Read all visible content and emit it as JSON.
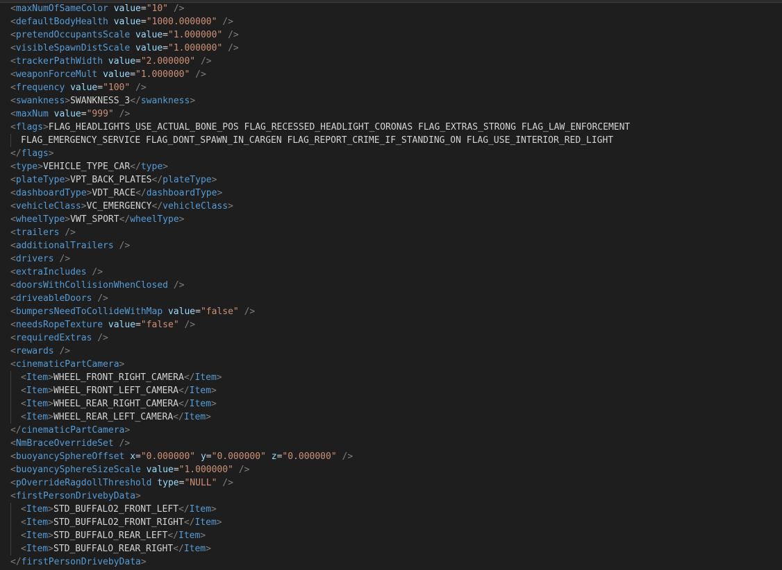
{
  "colors": {
    "background": "#1e1e1e",
    "punctuation": "#808080",
    "tag": "#569cd6",
    "attribute": "#9cdcfe",
    "string": "#ce9178",
    "text": "#d4d4d4"
  },
  "lines": [
    {
      "indent": 0,
      "tokens": [
        [
          "p",
          "<"
        ],
        [
          "t",
          "maxNumOfSameColor"
        ],
        [
          "x",
          " "
        ],
        [
          "a",
          "value"
        ],
        [
          "x",
          "="
        ],
        [
          "s",
          "\"10\""
        ],
        [
          "x",
          " "
        ],
        [
          "p",
          "/>"
        ]
      ]
    },
    {
      "indent": 0,
      "tokens": [
        [
          "p",
          "<"
        ],
        [
          "t",
          "defaultBodyHealth"
        ],
        [
          "x",
          " "
        ],
        [
          "a",
          "value"
        ],
        [
          "x",
          "="
        ],
        [
          "s",
          "\"1000.000000\""
        ],
        [
          "x",
          " "
        ],
        [
          "p",
          "/>"
        ]
      ]
    },
    {
      "indent": 0,
      "tokens": [
        [
          "p",
          "<"
        ],
        [
          "t",
          "pretendOccupantsScale"
        ],
        [
          "x",
          " "
        ],
        [
          "a",
          "value"
        ],
        [
          "x",
          "="
        ],
        [
          "s",
          "\"1.000000\""
        ],
        [
          "x",
          " "
        ],
        [
          "p",
          "/>"
        ]
      ]
    },
    {
      "indent": 0,
      "tokens": [
        [
          "p",
          "<"
        ],
        [
          "t",
          "visibleSpawnDistScale"
        ],
        [
          "x",
          " "
        ],
        [
          "a",
          "value"
        ],
        [
          "x",
          "="
        ],
        [
          "s",
          "\"1.000000\""
        ],
        [
          "x",
          " "
        ],
        [
          "p",
          "/>"
        ]
      ]
    },
    {
      "indent": 0,
      "tokens": [
        [
          "p",
          "<"
        ],
        [
          "t",
          "trackerPathWidth"
        ],
        [
          "x",
          " "
        ],
        [
          "a",
          "value"
        ],
        [
          "x",
          "="
        ],
        [
          "s",
          "\"2.000000\""
        ],
        [
          "x",
          " "
        ],
        [
          "p",
          "/>"
        ]
      ]
    },
    {
      "indent": 0,
      "tokens": [
        [
          "p",
          "<"
        ],
        [
          "t",
          "weaponForceMult"
        ],
        [
          "x",
          " "
        ],
        [
          "a",
          "value"
        ],
        [
          "x",
          "="
        ],
        [
          "s",
          "\"1.000000\""
        ],
        [
          "x",
          " "
        ],
        [
          "p",
          "/>"
        ]
      ]
    },
    {
      "indent": 0,
      "tokens": [
        [
          "p",
          "<"
        ],
        [
          "t",
          "frequency"
        ],
        [
          "x",
          " "
        ],
        [
          "a",
          "value"
        ],
        [
          "x",
          "="
        ],
        [
          "s",
          "\"100\""
        ],
        [
          "x",
          " "
        ],
        [
          "p",
          "/>"
        ]
      ]
    },
    {
      "indent": 0,
      "tokens": [
        [
          "p",
          "<"
        ],
        [
          "t",
          "swankness"
        ],
        [
          "p",
          ">"
        ],
        [
          "x",
          "SWANKNESS_3"
        ],
        [
          "p",
          "</"
        ],
        [
          "t",
          "swankness"
        ],
        [
          "p",
          ">"
        ]
      ]
    },
    {
      "indent": 0,
      "tokens": [
        [
          "p",
          "<"
        ],
        [
          "t",
          "maxNum"
        ],
        [
          "x",
          " "
        ],
        [
          "a",
          "value"
        ],
        [
          "x",
          "="
        ],
        [
          "s",
          "\"999\""
        ],
        [
          "x",
          " "
        ],
        [
          "p",
          "/>"
        ]
      ]
    },
    {
      "indent": 0,
      "tokens": [
        [
          "p",
          "<"
        ],
        [
          "t",
          "flags"
        ],
        [
          "p",
          ">"
        ],
        [
          "x",
          "FLAG_HEADLIGHTS_USE_ACTUAL_BONE_POS FLAG_RECESSED_HEADLIGHT_CORONAS FLAG_EXTRAS_STRONG FLAG_LAW_ENFORCEMENT"
        ]
      ]
    },
    {
      "indent": 1,
      "tokens": [
        [
          "x",
          "FLAG_EMERGENCY_SERVICE FLAG_DONT_SPAWN_IN_CARGEN FLAG_REPORT_CRIME_IF_STANDING_ON FLAG_USE_INTERIOR_RED_LIGHT"
        ]
      ]
    },
    {
      "indent": 0,
      "tokens": [
        [
          "p",
          "</"
        ],
        [
          "t",
          "flags"
        ],
        [
          "p",
          ">"
        ]
      ]
    },
    {
      "indent": 0,
      "tokens": [
        [
          "p",
          "<"
        ],
        [
          "t",
          "type"
        ],
        [
          "p",
          ">"
        ],
        [
          "x",
          "VEHICLE_TYPE_CAR"
        ],
        [
          "p",
          "</"
        ],
        [
          "t",
          "type"
        ],
        [
          "p",
          ">"
        ]
      ]
    },
    {
      "indent": 0,
      "tokens": [
        [
          "p",
          "<"
        ],
        [
          "t",
          "plateType"
        ],
        [
          "p",
          ">"
        ],
        [
          "x",
          "VPT_BACK_PLATES"
        ],
        [
          "p",
          "</"
        ],
        [
          "t",
          "plateType"
        ],
        [
          "p",
          ">"
        ]
      ]
    },
    {
      "indent": 0,
      "tokens": [
        [
          "p",
          "<"
        ],
        [
          "t",
          "dashboardType"
        ],
        [
          "p",
          ">"
        ],
        [
          "x",
          "VDT_RACE"
        ],
        [
          "p",
          "</"
        ],
        [
          "t",
          "dashboardType"
        ],
        [
          "p",
          ">"
        ]
      ]
    },
    {
      "indent": 0,
      "tokens": [
        [
          "p",
          "<"
        ],
        [
          "t",
          "vehicleClass"
        ],
        [
          "p",
          ">"
        ],
        [
          "x",
          "VC_EMERGENCY"
        ],
        [
          "p",
          "</"
        ],
        [
          "t",
          "vehicleClass"
        ],
        [
          "p",
          ">"
        ]
      ]
    },
    {
      "indent": 0,
      "tokens": [
        [
          "p",
          "<"
        ],
        [
          "t",
          "wheelType"
        ],
        [
          "p",
          ">"
        ],
        [
          "x",
          "VWT_SPORT"
        ],
        [
          "p",
          "</"
        ],
        [
          "t",
          "wheelType"
        ],
        [
          "p",
          ">"
        ]
      ]
    },
    {
      "indent": 0,
      "tokens": [
        [
          "p",
          "<"
        ],
        [
          "t",
          "trailers"
        ],
        [
          "x",
          " "
        ],
        [
          "p",
          "/>"
        ]
      ]
    },
    {
      "indent": 0,
      "tokens": [
        [
          "p",
          "<"
        ],
        [
          "t",
          "additionalTrailers"
        ],
        [
          "x",
          " "
        ],
        [
          "p",
          "/>"
        ]
      ]
    },
    {
      "indent": 0,
      "tokens": [
        [
          "p",
          "<"
        ],
        [
          "t",
          "drivers"
        ],
        [
          "x",
          " "
        ],
        [
          "p",
          "/>"
        ]
      ]
    },
    {
      "indent": 0,
      "tokens": [
        [
          "p",
          "<"
        ],
        [
          "t",
          "extraIncludes"
        ],
        [
          "x",
          " "
        ],
        [
          "p",
          "/>"
        ]
      ]
    },
    {
      "indent": 0,
      "tokens": [
        [
          "p",
          "<"
        ],
        [
          "t",
          "doorsWithCollisionWhenClosed"
        ],
        [
          "x",
          " "
        ],
        [
          "p",
          "/>"
        ]
      ]
    },
    {
      "indent": 0,
      "tokens": [
        [
          "p",
          "<"
        ],
        [
          "t",
          "driveableDoors"
        ],
        [
          "x",
          " "
        ],
        [
          "p",
          "/>"
        ]
      ]
    },
    {
      "indent": 0,
      "tokens": [
        [
          "p",
          "<"
        ],
        [
          "t",
          "bumpersNeedToCollideWithMap"
        ],
        [
          "x",
          " "
        ],
        [
          "a",
          "value"
        ],
        [
          "x",
          "="
        ],
        [
          "s",
          "\"false\""
        ],
        [
          "x",
          " "
        ],
        [
          "p",
          "/>"
        ]
      ]
    },
    {
      "indent": 0,
      "tokens": [
        [
          "p",
          "<"
        ],
        [
          "t",
          "needsRopeTexture"
        ],
        [
          "x",
          " "
        ],
        [
          "a",
          "value"
        ],
        [
          "x",
          "="
        ],
        [
          "s",
          "\"false\""
        ],
        [
          "x",
          " "
        ],
        [
          "p",
          "/>"
        ]
      ]
    },
    {
      "indent": 0,
      "tokens": [
        [
          "p",
          "<"
        ],
        [
          "t",
          "requiredExtras"
        ],
        [
          "x",
          " "
        ],
        [
          "p",
          "/>"
        ]
      ]
    },
    {
      "indent": 0,
      "tokens": [
        [
          "p",
          "<"
        ],
        [
          "t",
          "rewards"
        ],
        [
          "x",
          " "
        ],
        [
          "p",
          "/>"
        ]
      ]
    },
    {
      "indent": 0,
      "tokens": [
        [
          "p",
          "<"
        ],
        [
          "t",
          "cinematicPartCamera"
        ],
        [
          "p",
          ">"
        ]
      ]
    },
    {
      "indent": 1,
      "tokens": [
        [
          "p",
          "<"
        ],
        [
          "t",
          "Item"
        ],
        [
          "p",
          ">"
        ],
        [
          "x",
          "WHEEL_FRONT_RIGHT_CAMERA"
        ],
        [
          "p",
          "</"
        ],
        [
          "t",
          "Item"
        ],
        [
          "p",
          ">"
        ]
      ]
    },
    {
      "indent": 1,
      "tokens": [
        [
          "p",
          "<"
        ],
        [
          "t",
          "Item"
        ],
        [
          "p",
          ">"
        ],
        [
          "x",
          "WHEEL_FRONT_LEFT_CAMERA"
        ],
        [
          "p",
          "</"
        ],
        [
          "t",
          "Item"
        ],
        [
          "p",
          ">"
        ]
      ]
    },
    {
      "indent": 1,
      "tokens": [
        [
          "p",
          "<"
        ],
        [
          "t",
          "Item"
        ],
        [
          "p",
          ">"
        ],
        [
          "x",
          "WHEEL_REAR_RIGHT_CAMERA"
        ],
        [
          "p",
          "</"
        ],
        [
          "t",
          "Item"
        ],
        [
          "p",
          ">"
        ]
      ]
    },
    {
      "indent": 1,
      "tokens": [
        [
          "p",
          "<"
        ],
        [
          "t",
          "Item"
        ],
        [
          "p",
          ">"
        ],
        [
          "x",
          "WHEEL_REAR_LEFT_CAMERA"
        ],
        [
          "p",
          "</"
        ],
        [
          "t",
          "Item"
        ],
        [
          "p",
          ">"
        ]
      ]
    },
    {
      "indent": 0,
      "tokens": [
        [
          "p",
          "</"
        ],
        [
          "t",
          "cinematicPartCamera"
        ],
        [
          "p",
          ">"
        ]
      ]
    },
    {
      "indent": 0,
      "tokens": [
        [
          "p",
          "<"
        ],
        [
          "t",
          "NmBraceOverrideSet"
        ],
        [
          "x",
          " "
        ],
        [
          "p",
          "/>"
        ]
      ]
    },
    {
      "indent": 0,
      "tokens": [
        [
          "p",
          "<"
        ],
        [
          "t",
          "buoyancySphereOffset"
        ],
        [
          "x",
          " "
        ],
        [
          "a",
          "x"
        ],
        [
          "x",
          "="
        ],
        [
          "s",
          "\"0.000000\""
        ],
        [
          "x",
          " "
        ],
        [
          "a",
          "y"
        ],
        [
          "x",
          "="
        ],
        [
          "s",
          "\"0.000000\""
        ],
        [
          "x",
          " "
        ],
        [
          "a",
          "z"
        ],
        [
          "x",
          "="
        ],
        [
          "s",
          "\"0.000000\""
        ],
        [
          "x",
          " "
        ],
        [
          "p",
          "/>"
        ]
      ]
    },
    {
      "indent": 0,
      "tokens": [
        [
          "p",
          "<"
        ],
        [
          "t",
          "buoyancySphereSizeScale"
        ],
        [
          "x",
          " "
        ],
        [
          "a",
          "value"
        ],
        [
          "x",
          "="
        ],
        [
          "s",
          "\"1.000000\""
        ],
        [
          "x",
          " "
        ],
        [
          "p",
          "/>"
        ]
      ]
    },
    {
      "indent": 0,
      "tokens": [
        [
          "p",
          "<"
        ],
        [
          "t",
          "pOverrideRagdollThreshold"
        ],
        [
          "x",
          " "
        ],
        [
          "a",
          "type"
        ],
        [
          "x",
          "="
        ],
        [
          "s",
          "\"NULL\""
        ],
        [
          "x",
          " "
        ],
        [
          "p",
          "/>"
        ]
      ]
    },
    {
      "indent": 0,
      "tokens": [
        [
          "p",
          "<"
        ],
        [
          "t",
          "firstPersonDrivebyData"
        ],
        [
          "p",
          ">"
        ]
      ]
    },
    {
      "indent": 1,
      "tokens": [
        [
          "p",
          "<"
        ],
        [
          "t",
          "Item"
        ],
        [
          "p",
          ">"
        ],
        [
          "x",
          "STD_BUFFALO2_FRONT_LEFT"
        ],
        [
          "p",
          "</"
        ],
        [
          "t",
          "Item"
        ],
        [
          "p",
          ">"
        ]
      ]
    },
    {
      "indent": 1,
      "tokens": [
        [
          "p",
          "<"
        ],
        [
          "t",
          "Item"
        ],
        [
          "p",
          ">"
        ],
        [
          "x",
          "STD_BUFFALO2_FRONT_RIGHT"
        ],
        [
          "p",
          "</"
        ],
        [
          "t",
          "Item"
        ],
        [
          "p",
          ">"
        ]
      ]
    },
    {
      "indent": 1,
      "tokens": [
        [
          "p",
          "<"
        ],
        [
          "t",
          "Item"
        ],
        [
          "p",
          ">"
        ],
        [
          "x",
          "STD_BUFFALO_REAR_LEFT"
        ],
        [
          "p",
          "</"
        ],
        [
          "t",
          "Item"
        ],
        [
          "p",
          ">"
        ]
      ]
    },
    {
      "indent": 1,
      "tokens": [
        [
          "p",
          "<"
        ],
        [
          "t",
          "Item"
        ],
        [
          "p",
          ">"
        ],
        [
          "x",
          "STD_BUFFALO_REAR_RIGHT"
        ],
        [
          "p",
          "</"
        ],
        [
          "t",
          "Item"
        ],
        [
          "p",
          ">"
        ]
      ]
    },
    {
      "indent": 0,
      "tokens": [
        [
          "p",
          "</"
        ],
        [
          "t",
          "firstPersonDrivebyData"
        ],
        [
          "p",
          ">"
        ]
      ]
    }
  ]
}
